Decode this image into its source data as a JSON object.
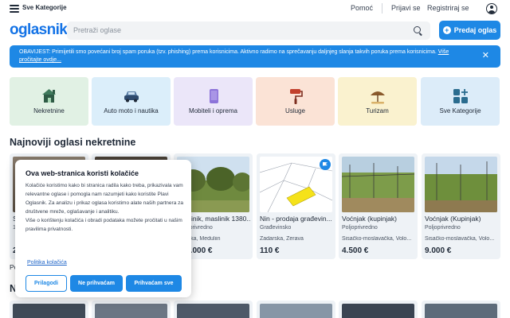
{
  "topbar": {
    "categories_label": "Sve Kategorije",
    "help": "Pomoć",
    "login": "Prijavi se",
    "register": "Registriraj se"
  },
  "header": {
    "logo": "oglasnik",
    "search_placeholder": "Pretraži oglase",
    "post_button": "Predaj oglas"
  },
  "notice": {
    "text": "OBAVIJEST: Primijetili smo povećani broj spam poruka (tzv. phishing) prema korisnicima. Aktivno radimo na sprečavanju daljnjeg slanja takvih poruka prema korisnicima. ",
    "link": "Više pročitajte ovdje..."
  },
  "categories": [
    {
      "label": "Nekretnine",
      "icon": "house-icon",
      "bg": "#e1f1e4"
    },
    {
      "label": "Auto moto i nautika",
      "icon": "car-icon",
      "bg": "#dbeefa"
    },
    {
      "label": "Mobiteli i oprema",
      "icon": "phone-icon",
      "bg": "#ebe6f9"
    },
    {
      "label": "Usluge",
      "icon": "paint-roller-icon",
      "bg": "#fbe3d6"
    },
    {
      "label": "Turizam",
      "icon": "beach-umbrella-icon",
      "bg": "#faf2cf"
    },
    {
      "label": "Sve Kategorije",
      "icon": "grid-plus-icon",
      "bg": "#dcecf9"
    }
  ],
  "section_real_estate": "Najnoviji oglasi nekretnine",
  "listings": [
    {
      "title": "S",
      "category": "1",
      "location": "",
      "price": "2"
    },
    {
      "title": "",
      "category": "",
      "location": "",
      "price": ""
    },
    {
      "title": "Maslinik, maslinik 1380...",
      "category": "Poljoprivredno",
      "location": "Istarska, Meduliin",
      "price": "120.000 €"
    },
    {
      "title": "Nin - prodaja građevin...",
      "category": "Građevinsko",
      "location": "Zadarska, Zerava",
      "price": "110 €"
    },
    {
      "title": "Voćnjak (kupinjak)",
      "category": "Poljoprivredno",
      "location": "Sisačko-moslavačka, Volo...",
      "price": "4.500 €"
    },
    {
      "title": "Voćnjak (Kupinjak)",
      "category": "Poljoprivredno",
      "location": "Sisačko-moslavačka, Volo...",
      "price": "9.000 €"
    }
  ],
  "partial_more": "Po",
  "section2_partial": "N",
  "cookie": {
    "title": "Ova web-stranica koristi kolačiće",
    "body1": "Kolačiće koristimo kako bi stranica radila kako treba, prikazivala vam relevantne oglase i pomogla nam razumjeti kako koristite Plavi Oglasnik. Za analizu i prikaz oglasa koristimo alate naših partnera za društvene mreže, oglašavanje i analitiku.",
    "body2": "Više o korištenju kolačića i obradi podataka možete pročitati u našim pravilima privatnosti.",
    "policy_link": "Politika kolačića",
    "customize": "Prilagodi",
    "reject": "Ne prihvaćam",
    "accept": "Prihvaćam sve"
  },
  "colors": {
    "brand": "#1473e6",
    "accent": "#1e88e5"
  }
}
